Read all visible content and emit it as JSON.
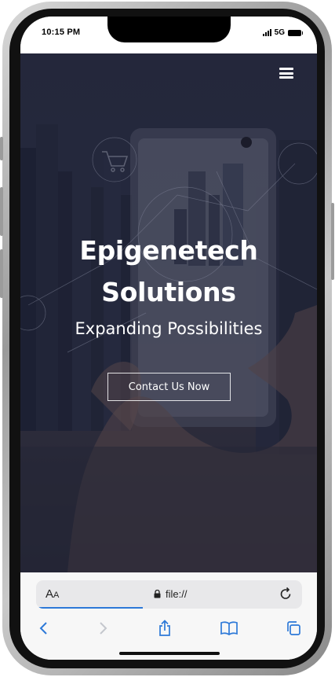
{
  "status_bar": {
    "time": "10:15 PM",
    "network": "5G",
    "icons": [
      "signal-icon",
      "battery-icon"
    ]
  },
  "hero": {
    "menu_icon": "hamburger-icon",
    "title_line1": "Epigenetech",
    "title_line2": "Solutions",
    "subtitle": "Expanding Possibilities",
    "cta_label": "Contact Us Now"
  },
  "browser": {
    "text_size_label": "AA",
    "url": "file://",
    "icons": [
      "lock-icon",
      "reload-icon",
      "back-icon",
      "forward-icon",
      "share-icon",
      "bookmarks-icon",
      "tabs-icon"
    ]
  },
  "colors": {
    "accent": "#2d79d8",
    "hero_overlay": "#1c1e34",
    "text_light": "#ffffff"
  }
}
